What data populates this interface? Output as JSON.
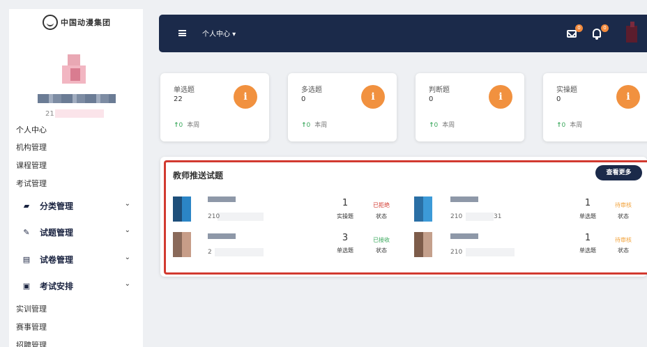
{
  "sidebar": {
    "logo_text": "中国动漫集团",
    "user_id_prefix": "21",
    "items": [
      {
        "label": "个人中心"
      },
      {
        "label": "机构管理"
      },
      {
        "label": "课程管理"
      },
      {
        "label": "考试管理"
      }
    ],
    "groups": [
      {
        "label": "分类管理",
        "icon": "category-icon"
      },
      {
        "label": "试题管理",
        "icon": "pen-icon"
      },
      {
        "label": "试卷管理",
        "icon": "paper-icon"
      },
      {
        "label": "考试安排",
        "icon": "exam-icon"
      }
    ],
    "bottom_items": [
      {
        "label": "实训管理"
      },
      {
        "label": "赛事管理"
      },
      {
        "label": "招聘管理"
      }
    ]
  },
  "topbar": {
    "breadcrumb": "个人中心 ▾",
    "mail_badge": "0",
    "bell_badge": "0"
  },
  "cards": [
    {
      "title": "单选题",
      "value": "22",
      "delta": "0",
      "period": "本周"
    },
    {
      "title": "多选题",
      "value": "0",
      "delta": "0",
      "period": "本周"
    },
    {
      "title": "判断题",
      "value": "0",
      "delta": "0",
      "period": "本周"
    },
    {
      "title": "实操题",
      "value": "0",
      "delta": "0",
      "period": "本周"
    }
  ],
  "recommend": {
    "title": "教师推送试题",
    "more_label": "查看更多",
    "status_label": "状态",
    "rows": [
      {
        "id_prefix": "210",
        "count": "1",
        "type": "实操题",
        "status": "已拒绝",
        "status_color": "#d23a30"
      },
      {
        "id_prefix": "210",
        "id_suffix": "31",
        "count": "1",
        "type": "单选题",
        "status": "待审核",
        "status_color": "#f2a23a"
      },
      {
        "id_prefix": "2",
        "count": "3",
        "type": "单选题",
        "status": "已接收",
        "status_color": "#3aa85c"
      },
      {
        "id_prefix": "210",
        "count": "1",
        "type": "单选题",
        "status": "待审核",
        "status_color": "#f2a23a"
      }
    ]
  }
}
